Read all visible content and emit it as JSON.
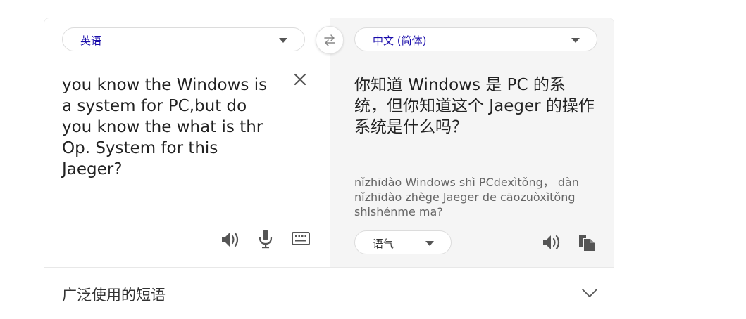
{
  "source": {
    "language": "英语",
    "text": "you know the Windows is a system for PC,but do you know the what is thr Op. System for this Jaeger?"
  },
  "target": {
    "language": "中文 (简体)",
    "text": "你知道 Windows 是 PC 的系统，但你知道这个 Jaeger 的操作系统是什么吗？",
    "pinyin": "nǐzhīdào Windows shì PCdexìtǒng， dàn nǐzhīdào zhège Jaeger de cāozuòxìtǒng shishénme ma?",
    "tone": "语气"
  },
  "phrases": {
    "title": "广泛使用的短语"
  },
  "icons": {
    "swap": "swap-arrows-icon",
    "clear": "close-icon",
    "speaker": "speaker-icon",
    "mic": "microphone-icon",
    "keyboard": "keyboard-icon",
    "copy": "copy-icon",
    "chevron": "chevron-down-icon"
  },
  "colors": {
    "language_link": "#1a0dab",
    "target_pane_bg": "#f5f5f5",
    "icon": "#555555"
  }
}
